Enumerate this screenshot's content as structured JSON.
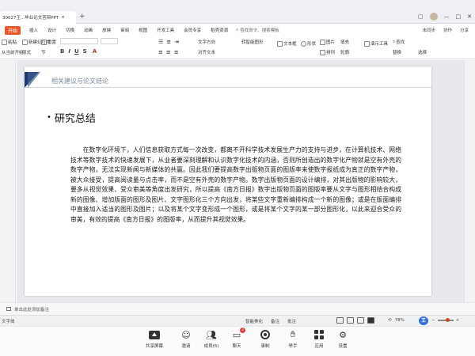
{
  "window": {
    "tab_title": "30027王...毕业论文答辩PPT",
    "new_tab": "+"
  },
  "menu": {
    "start": "开始",
    "items": [
      "插入",
      "设计",
      "切换",
      "动画",
      "放映",
      "审阅",
      "视图",
      "开发工具",
      "会员专享",
      "稻壳资源"
    ],
    "search": "查找命令、搜索模板",
    "right": [
      "未同步",
      "协作",
      "分享"
    ]
  },
  "toolbar": {
    "row1": {
      "paste": "粘贴",
      "new_slide": "新建幻灯片",
      "layout": "版式",
      "section": "节",
      "reset": "重置",
      "textbox": "文本框",
      "shape": "形状",
      "image": "图片",
      "arrange": "排列",
      "outline": "轮廓",
      "play": "演示工具",
      "find": "查找",
      "replace": "替换",
      "select": "选择"
    },
    "row2": {
      "from_current": "从当前开始",
      "format": "格式",
      "text_direction": "文字方向",
      "align_text": "对齐文本",
      "smartart": "转智能图形",
      "fill": "填充",
      "outline2": "轮廓"
    }
  },
  "slide": {
    "header": "相关建议与论文结论",
    "title": "研究总结",
    "bullet": "•",
    "body": "在数字化环境下，人们信息获取方式每一次改变，都离不开科学技术发展生产力的支持与进步，在计算机技术、网络技术等数字技术的快速发展下，从业者要深刻理解和认识数字化技术的内涵，否则所创造出的数字化产物就是空有外壳的数字产物，无法实现新闻与新媒体的共赢。因此我们要提高数字出版物页面的图版率来使数字报纸成为真正的数字产物，被大众接受，提高阅读量与点击率，而不是空有外壳的数字产物。数字出版物页面的设计编排，对其出版物的影响较大，要多从视觉效果、受众审美等角度出发研究，所以提高《南方日报》数字出版物页面的图版率要从文字与图形相结合构成新的图像、增加版面的图形及图片、文字图形化三个方向出发，将某些文字重新编排构成一个新的图像；或是在版面编排中直接加入适当的图形及图片；以及将某个文字变形成一个图形，或是将某个文字的某一部分图形化，以此来迎合受众的审美，有效的提高《南方日报》的图版率，从而提升其视觉效果。"
  },
  "notes": {
    "placeholder": "单击此处添加备注"
  },
  "status": {
    "font": "文字体",
    "smart_beautify": "智能美化",
    "notes": "备注",
    "comments": "批注",
    "zoom": "78%",
    "wps": "王"
  },
  "meeting": {
    "buttons": [
      {
        "label": "共享屏幕"
      },
      {
        "label": "邀请"
      },
      {
        "label": "成员(5)"
      },
      {
        "label": "聊天",
        "badge": "2"
      },
      {
        "label": "录制"
      },
      {
        "label": "举手"
      },
      {
        "label": "应用"
      },
      {
        "label": "设置"
      }
    ]
  }
}
